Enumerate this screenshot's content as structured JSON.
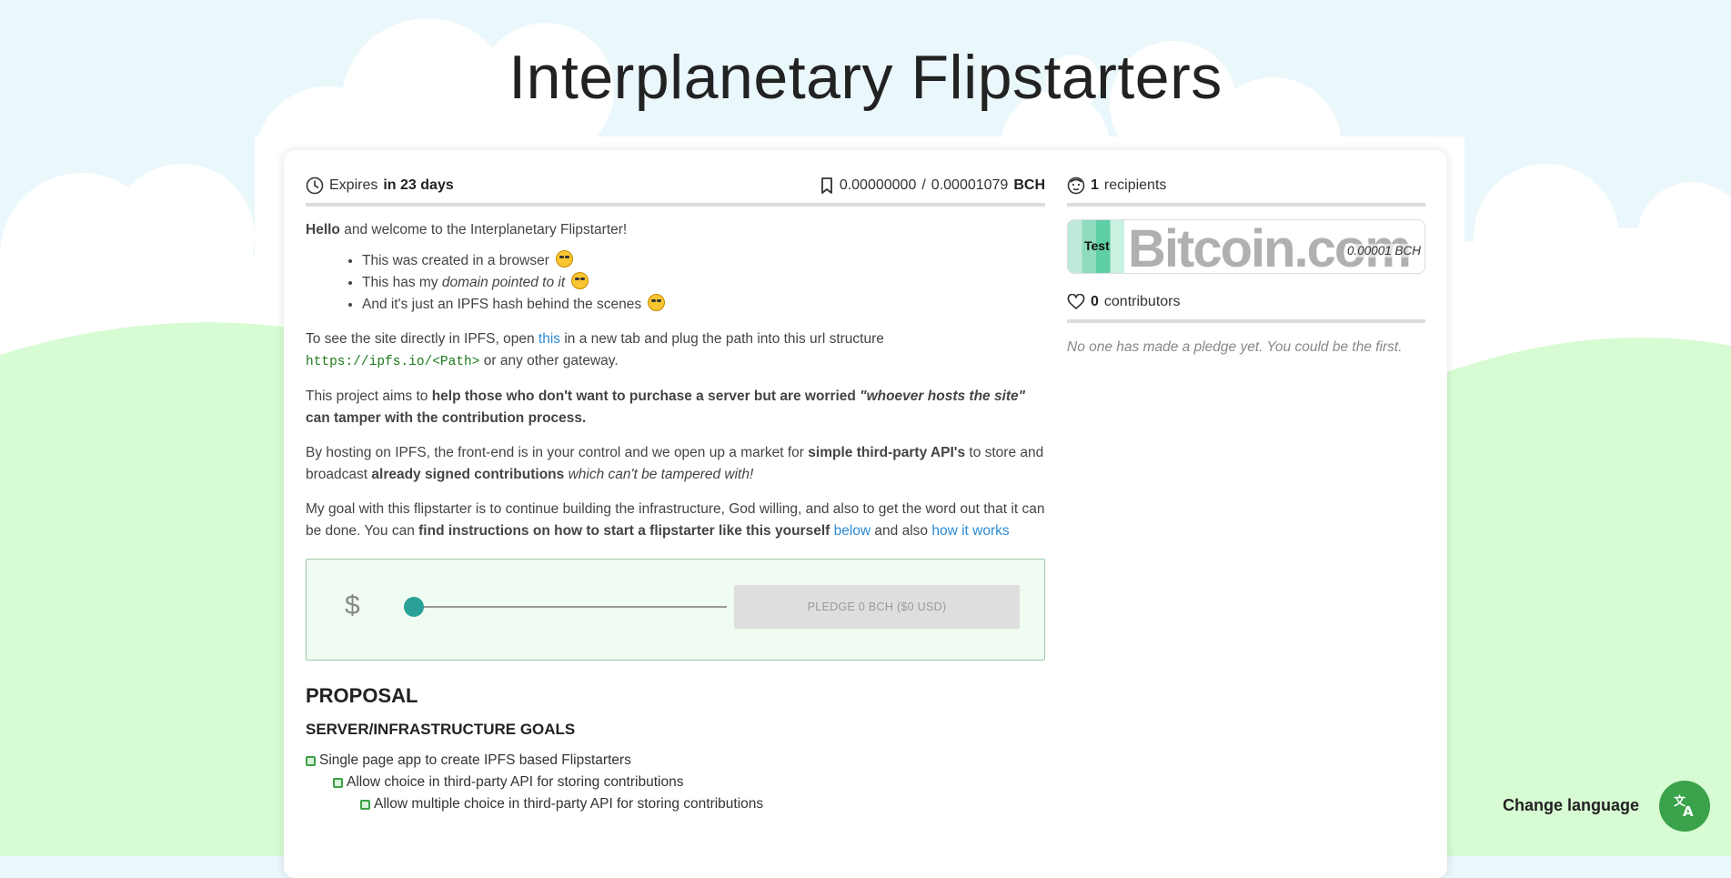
{
  "page": {
    "title": "Interplanetary Flipstarters"
  },
  "stats": {
    "expires_prefix": "Expires",
    "expires_value": "in 23 days",
    "raised": "0.00000000",
    "separator": "/",
    "goal": "0.00001079",
    "currency": "BCH"
  },
  "intro": {
    "greeting_bold": "Hello",
    "greeting_rest": "and welcome to the Interplanetary Flipstarter!",
    "bullets": [
      {
        "text": "This was created in a browser",
        "emoji": "sunglasses-emoji"
      },
      {
        "text_plain": "This has my",
        "text_italic": "domain pointed to it",
        "emoji": "star-struck-emoji"
      },
      {
        "text": "And it's just an IPFS hash behind the scenes",
        "emoji": "exploding-head-emoji"
      }
    ],
    "ipfs_p1": "To see the site directly in IPFS, open",
    "ipfs_link": "this",
    "ipfs_p2": "in a new tab and plug the path into this url structure",
    "ipfs_url": "https://ipfs.io/<Path>",
    "ipfs_p3": "or any other gateway.",
    "aim_p1": "This project aims to",
    "aim_bold": "help those who don't want to purchase a server but are worried",
    "aim_quote": "\"whoever hosts the site\"",
    "aim_bold2": "can tamper with the contribution process.",
    "host_p1": "By hosting on IPFS, the front-end is in your control and we open up a market for",
    "host_bold1": "simple third-party API's",
    "host_p2": "to store and broadcast",
    "host_bold2": "already signed contributions",
    "host_italic": "which can't be tampered with!",
    "goal_p1": "My goal with this flipstarter is to continue building the infrastructure, God willing, and also to get the word out that it can be done. You can",
    "goal_bold": "find instructions on how to start a flipstarter like this yourself",
    "goal_link1": "below",
    "goal_p2": "and also",
    "goal_link2": "how it works"
  },
  "pledge": {
    "currency_symbol": "$",
    "slider_value": 0,
    "button_label": "PLEDGE 0 BCH ($0 USD)"
  },
  "proposal": {
    "heading": "PROPOSAL",
    "subheading": "SERVER/INFRASTRUCTURE GOALS",
    "goals": [
      {
        "label": "Single page app to create IPFS based Flipstarters",
        "level": 0
      },
      {
        "label": "Allow choice in third-party API for storing contributions",
        "level": 1
      },
      {
        "label": "Allow multiple choice in third-party API for storing contributions",
        "level": 2
      }
    ]
  },
  "recipients": {
    "count": "1",
    "label": "recipients",
    "items": [
      {
        "name": "Test",
        "brand": "Bitcoin.com",
        "amount": "0.00001 BCH"
      }
    ]
  },
  "contributors": {
    "count": "0",
    "label": "contributors",
    "empty_message": "No one has made a pledge yet. You could be the first."
  },
  "language": {
    "label": "Change language",
    "icon": "translate-icon"
  },
  "colors": {
    "accent_green": "#3aa24a",
    "slider_teal": "#2aa198",
    "link_blue": "#2a8bd6",
    "sky": "#eaf7fb",
    "hill": "#d9fbd4"
  }
}
